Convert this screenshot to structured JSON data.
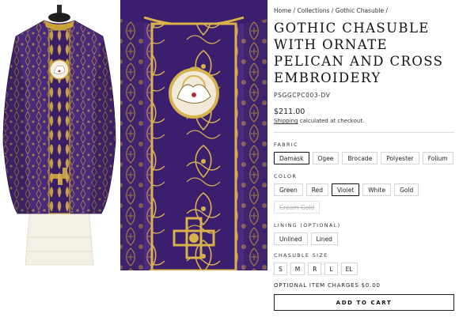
{
  "breadcrumb": [
    "Home",
    "Collections",
    "Gothic Chasuble"
  ],
  "title": "Gothic Chasuble with Ornate Pelican and Cross Embroidery",
  "sku": "PSGGCPC003-DV",
  "price": "$211.00",
  "shipping": {
    "link": "Shipping",
    "text": " calculated at checkout."
  },
  "fabric": {
    "label": "Fabric",
    "options": [
      "Damask",
      "Ogee",
      "Brocade",
      "Polyester",
      "Folium"
    ],
    "selected": "Damask"
  },
  "color": {
    "label": "Color",
    "options": [
      "Green",
      "Red",
      "Violet",
      "White",
      "Gold"
    ],
    "extra_option": "Cream Gold",
    "selected": "Violet"
  },
  "lining": {
    "label": "Lining (optional)",
    "options": [
      "Unlined",
      "Lined"
    ]
  },
  "size": {
    "label": "Chasuble Size",
    "options": [
      "S",
      "M",
      "R",
      "L",
      "EL"
    ]
  },
  "charges": "Optional Item Charges $0.00",
  "cart_button": "Add to Cart",
  "colors": {
    "violet": "#4a2a7a",
    "gold": "#c9a23a",
    "text": "#1a1a1a"
  }
}
